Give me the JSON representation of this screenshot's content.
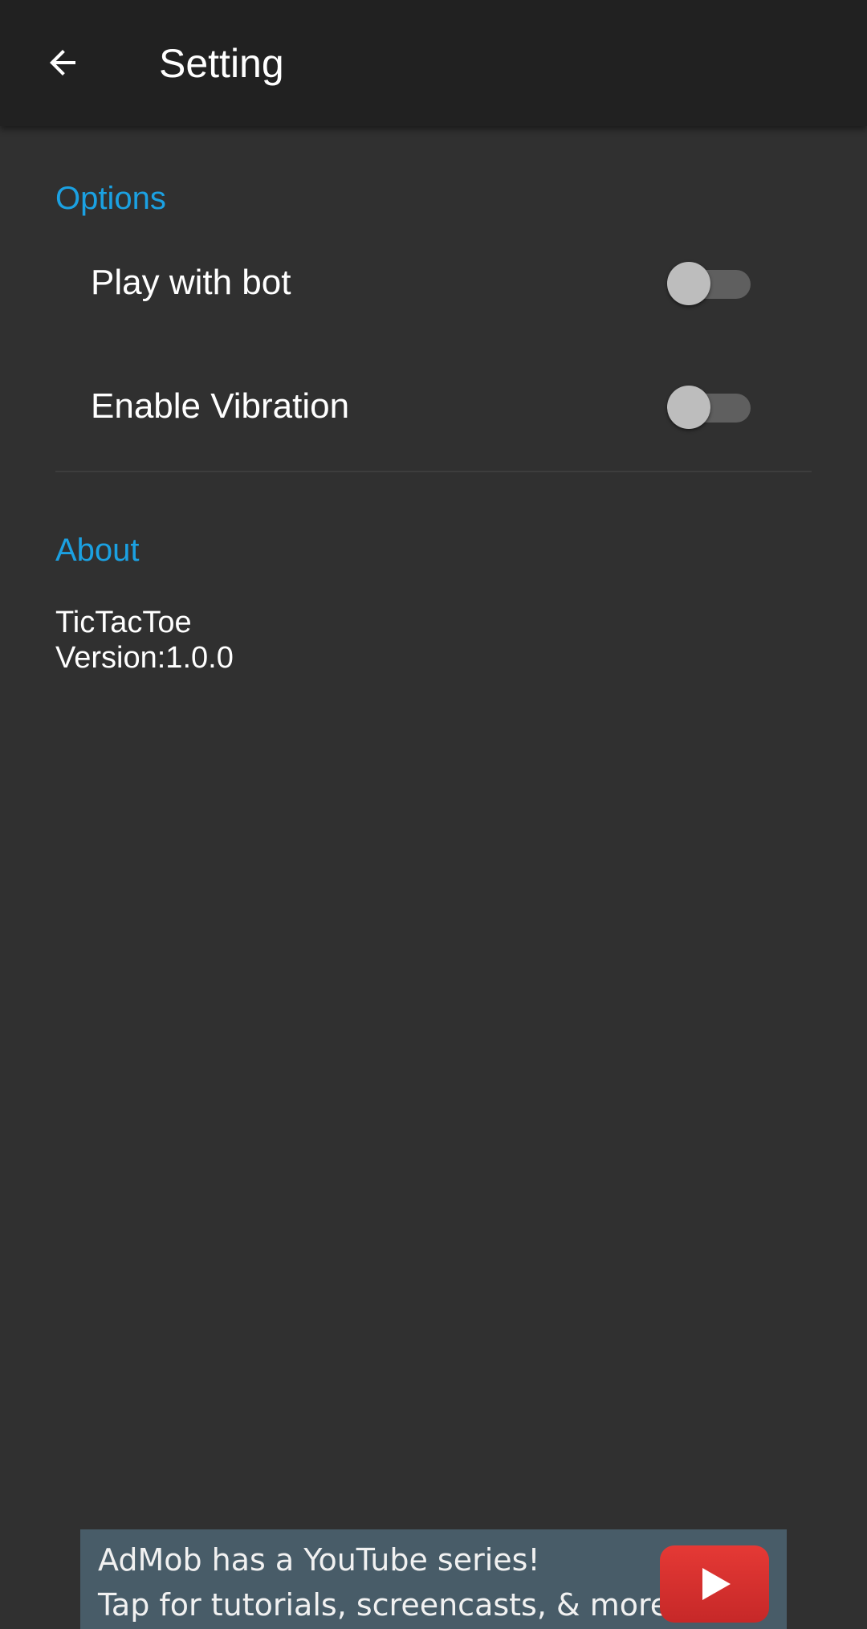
{
  "app_bar": {
    "back_icon": "arrow-back-icon",
    "title": "Setting"
  },
  "options": {
    "header": "Options",
    "items": [
      {
        "label": "Play with bot",
        "enabled": false
      },
      {
        "label": "Enable Vibration",
        "enabled": false
      }
    ]
  },
  "about": {
    "header": "About",
    "app_name": "TicTacToe",
    "version": "Version:1.0.0"
  },
  "ad": {
    "line1": "AdMob has a YouTube series!",
    "line2": "Tap for tutorials, screencasts, & more.",
    "icon": "youtube-play-icon"
  },
  "colors": {
    "accent": "#1ba1e2",
    "background": "#303030",
    "app_bar": "#212121",
    "ad_background": "#485c68",
    "youtube_red": "#e53935"
  }
}
